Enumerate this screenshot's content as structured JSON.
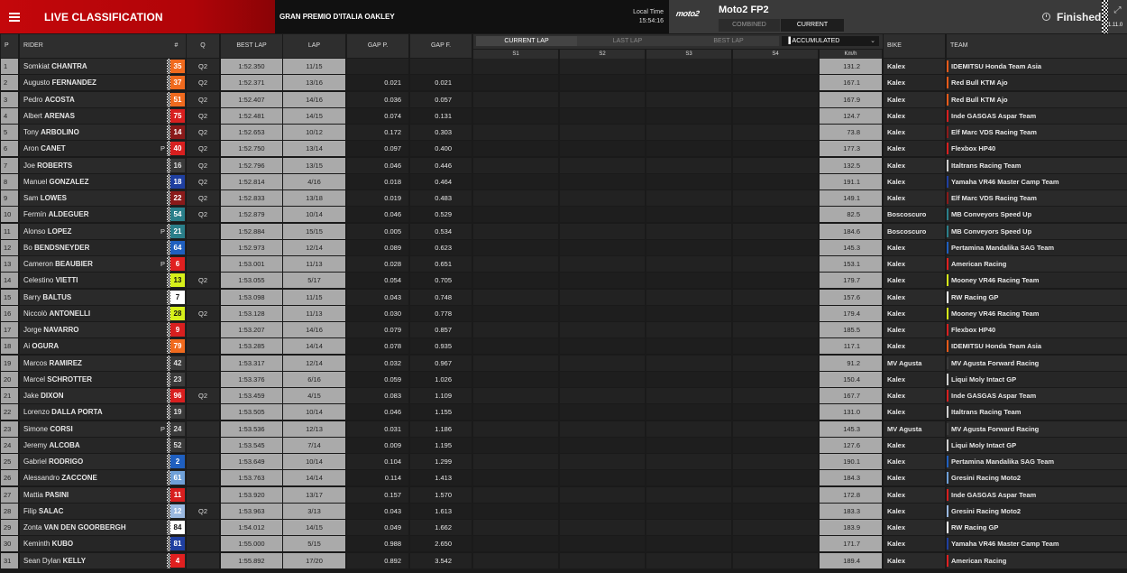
{
  "header": {
    "title": "LIVE CLASSIFICATION",
    "event": "GRAN PREMIO D'ITALIA OAKLEY",
    "local_time_label": "Local Time",
    "local_time": "15:54:16",
    "series_logo": "moto2",
    "session": "Moto2 FP2",
    "tabs": [
      "COMBINED",
      "CURRENT"
    ],
    "active_tab": "CURRENT",
    "status": "Finished",
    "version": "1.11.0"
  },
  "columns": {
    "p": "P",
    "rider": "RIDER",
    "num": "#",
    "q": "Q",
    "best_lap": "BEST LAP",
    "lap": "LAP",
    "gap_p": "GAP P.",
    "gap_f": "GAP F.",
    "bike": "BIKE",
    "team": "TEAM",
    "lap_tabs": [
      "CURRENT LAP",
      "LAST LAP",
      "BEST LAP"
    ],
    "accumulated": "ACCUMULATED",
    "sectors": [
      "S1",
      "S2",
      "S3",
      "S4"
    ],
    "kmh": "Km/h"
  },
  "rows": [
    {
      "p": "1",
      "first": "Somkiat",
      "last": "CHANTRA",
      "pit": "",
      "num": "35",
      "num_bg": "#f06a1e",
      "num_fg": "#ffffff",
      "q": "Q2",
      "best": "1:52.350",
      "lap": "11/15",
      "gapp": "",
      "gapf": "",
      "kmh": "131.2",
      "bike": "Kalex",
      "team": "IDEMITSU Honda Team Asia",
      "tcol": "#e85a1a"
    },
    {
      "p": "2",
      "first": "Augusto",
      "last": "FERNANDEZ",
      "pit": "",
      "num": "37",
      "num_bg": "#f06a1e",
      "num_fg": "#ffffff",
      "q": "Q2",
      "best": "1:52.371",
      "lap": "13/16",
      "gapp": "0.021",
      "gapf": "0.021",
      "kmh": "167.1",
      "bike": "Kalex",
      "team": "Red Bull KTM Ajo",
      "tcol": "#e85a1a"
    },
    {
      "p": "3",
      "first": "Pedro",
      "last": "ACOSTA",
      "pit": "",
      "num": "51",
      "num_bg": "#f06a1e",
      "num_fg": "#ffffff",
      "q": "Q2",
      "best": "1:52.407",
      "lap": "14/16",
      "gapp": "0.036",
      "gapf": "0.057",
      "kmh": "167.9",
      "bike": "Kalex",
      "team": "Red Bull KTM Ajo",
      "tcol": "#e85a1a"
    },
    {
      "p": "4",
      "first": "Albert",
      "last": "ARENAS",
      "pit": "",
      "num": "75",
      "num_bg": "#d81f1f",
      "num_fg": "#ffffff",
      "q": "Q2",
      "best": "1:52.481",
      "lap": "14/15",
      "gapp": "0.074",
      "gapf": "0.131",
      "kmh": "124.7",
      "bike": "Kalex",
      "team": "Inde GASGAS Aspar Team",
      "tcol": "#d81f1f"
    },
    {
      "p": "5",
      "first": "Tony",
      "last": "ARBOLINO",
      "pit": "",
      "num": "14",
      "num_bg": "#8a1a1a",
      "num_fg": "#ffffff",
      "q": "Q2",
      "best": "1:52.653",
      "lap": "10/12",
      "gapp": "0.172",
      "gapf": "0.303",
      "kmh": "73.8",
      "bike": "Kalex",
      "team": "Elf Marc VDS Racing Team",
      "tcol": "#8a1a1a"
    },
    {
      "p": "6",
      "first": "Aron",
      "last": "CANET",
      "pit": "P",
      "num": "40",
      "num_bg": "#d81f1f",
      "num_fg": "#ffffff",
      "q": "Q2",
      "best": "1:52.750",
      "lap": "13/14",
      "gapp": "0.097",
      "gapf": "0.400",
      "kmh": "177.3",
      "bike": "Kalex",
      "team": "Flexbox HP40",
      "tcol": "#d81f1f"
    },
    {
      "p": "7",
      "first": "Joe",
      "last": "ROBERTS",
      "pit": "",
      "num": "16",
      "num_bg": "#3a3a3a",
      "num_fg": "#e0e0e0",
      "q": "Q2",
      "best": "1:52.796",
      "lap": "13/15",
      "gapp": "0.046",
      "gapf": "0.446",
      "kmh": "132.5",
      "bike": "Kalex",
      "team": "Italtrans Racing Team",
      "tcol": "#cfcfcf"
    },
    {
      "p": "8",
      "first": "Manuel",
      "last": "GONZALEZ",
      "pit": "",
      "num": "18",
      "num_bg": "#1f3fa0",
      "num_fg": "#ffffff",
      "q": "Q2",
      "best": "1:52.814",
      "lap": "4/16",
      "gapp": "0.018",
      "gapf": "0.464",
      "kmh": "191.1",
      "bike": "Kalex",
      "team": "Yamaha VR46 Master Camp Team",
      "tcol": "#1f3fa0"
    },
    {
      "p": "9",
      "first": "Sam",
      "last": "LOWES",
      "pit": "",
      "num": "22",
      "num_bg": "#8a1a1a",
      "num_fg": "#ffffff",
      "q": "Q2",
      "best": "1:52.833",
      "lap": "13/18",
      "gapp": "0.019",
      "gapf": "0.483",
      "kmh": "149.1",
      "bike": "Kalex",
      "team": "Elf Marc VDS Racing Team",
      "tcol": "#8a1a1a"
    },
    {
      "p": "10",
      "first": "Fermín",
      "last": "ALDEGUER",
      "pit": "",
      "num": "54",
      "num_bg": "#2a7f8a",
      "num_fg": "#ffffff",
      "q": "Q2",
      "best": "1:52.879",
      "lap": "10/14",
      "gapp": "0.046",
      "gapf": "0.529",
      "kmh": "82.5",
      "bike": "Boscoscuro",
      "team": "MB Conveyors Speed Up",
      "tcol": "#2a7f8a"
    },
    {
      "p": "11",
      "first": "Alonso",
      "last": "LOPEZ",
      "pit": "P",
      "num": "21",
      "num_bg": "#2a7f8a",
      "num_fg": "#ffffff",
      "q": "",
      "best": "1:52.884",
      "lap": "15/15",
      "gapp": "0.005",
      "gapf": "0.534",
      "kmh": "184.6",
      "bike": "Boscoscuro",
      "team": "MB Conveyors Speed Up",
      "tcol": "#2a7f8a"
    },
    {
      "p": "12",
      "first": "Bo",
      "last": "BENDSNEYDER",
      "pit": "",
      "num": "64",
      "num_bg": "#1f5fbf",
      "num_fg": "#ffffff",
      "q": "",
      "best": "1:52.973",
      "lap": "12/14",
      "gapp": "0.089",
      "gapf": "0.623",
      "kmh": "145.3",
      "bike": "Kalex",
      "team": "Pertamina Mandalika SAG Team",
      "tcol": "#1f5fbf"
    },
    {
      "p": "13",
      "first": "Cameron",
      "last": "BEAUBIER",
      "pit": "P",
      "num": "6",
      "num_bg": "#e02020",
      "num_fg": "#ffffff",
      "q": "",
      "best": "1:53.001",
      "lap": "11/13",
      "gapp": "0.028",
      "gapf": "0.651",
      "kmh": "153.1",
      "bike": "Kalex",
      "team": "American Racing",
      "tcol": "#e02020"
    },
    {
      "p": "14",
      "first": "Celestino",
      "last": "VIETTI",
      "pit": "",
      "num": "13",
      "num_bg": "#d7f01a",
      "num_fg": "#111111",
      "q": "Q2",
      "best": "1:53.055",
      "lap": "5/17",
      "gapp": "0.054",
      "gapf": "0.705",
      "kmh": "179.7",
      "bike": "Kalex",
      "team": "Mooney VR46 Racing Team",
      "tcol": "#d7f01a"
    },
    {
      "p": "15",
      "first": "Barry",
      "last": "BALTUS",
      "pit": "",
      "num": "7",
      "num_bg": "#ffffff",
      "num_fg": "#111111",
      "q": "",
      "best": "1:53.098",
      "lap": "11/15",
      "gapp": "0.043",
      "gapf": "0.748",
      "kmh": "157.6",
      "bike": "Kalex",
      "team": "RW Racing GP",
      "tcol": "#ffffff"
    },
    {
      "p": "16",
      "first": "Niccolò",
      "last": "ANTONELLI",
      "pit": "",
      "num": "28",
      "num_bg": "#d7f01a",
      "num_fg": "#111111",
      "q": "Q2",
      "best": "1:53.128",
      "lap": "11/13",
      "gapp": "0.030",
      "gapf": "0.778",
      "kmh": "179.4",
      "bike": "Kalex",
      "team": "Mooney VR46 Racing Team",
      "tcol": "#d7f01a"
    },
    {
      "p": "17",
      "first": "Jorge",
      "last": "NAVARRO",
      "pit": "",
      "num": "9",
      "num_bg": "#d81f1f",
      "num_fg": "#ffffff",
      "q": "",
      "best": "1:53.207",
      "lap": "14/16",
      "gapp": "0.079",
      "gapf": "0.857",
      "kmh": "185.5",
      "bike": "Kalex",
      "team": "Flexbox HP40",
      "tcol": "#d81f1f"
    },
    {
      "p": "18",
      "first": "Ai",
      "last": "OGURA",
      "pit": "",
      "num": "79",
      "num_bg": "#f06a1e",
      "num_fg": "#ffffff",
      "q": "",
      "best": "1:53.285",
      "lap": "14/14",
      "gapp": "0.078",
      "gapf": "0.935",
      "kmh": "117.1",
      "bike": "Kalex",
      "team": "IDEMITSU Honda Team Asia",
      "tcol": "#e85a1a"
    },
    {
      "p": "19",
      "first": "Marcos",
      "last": "RAMIREZ",
      "pit": "",
      "num": "42",
      "num_bg": "#3a3a3a",
      "num_fg": "#e0e0e0",
      "q": "",
      "best": "1:53.317",
      "lap": "12/14",
      "gapp": "0.032",
      "gapf": "0.967",
      "kmh": "91.2",
      "bike": "MV Agusta",
      "team": "MV Agusta Forward Racing",
      "tcol": "#3a3a3a"
    },
    {
      "p": "20",
      "first": "Marcel",
      "last": "SCHROTTER",
      "pit": "",
      "num": "23",
      "num_bg": "#3a3a3a",
      "num_fg": "#e0e0e0",
      "q": "",
      "best": "1:53.376",
      "lap": "6/16",
      "gapp": "0.059",
      "gapf": "1.026",
      "kmh": "150.4",
      "bike": "Kalex",
      "team": "Liqui Moly Intact GP",
      "tcol": "#cfcfcf"
    },
    {
      "p": "21",
      "first": "Jake",
      "last": "DIXON",
      "pit": "",
      "num": "96",
      "num_bg": "#d81f1f",
      "num_fg": "#ffffff",
      "q": "Q2",
      "best": "1:53.459",
      "lap": "4/15",
      "gapp": "0.083",
      "gapf": "1.109",
      "kmh": "167.7",
      "bike": "Kalex",
      "team": "Inde GASGAS Aspar Team",
      "tcol": "#d81f1f"
    },
    {
      "p": "22",
      "first": "Lorenzo",
      "last": "DALLA PORTA",
      "pit": "",
      "num": "19",
      "num_bg": "#3a3a3a",
      "num_fg": "#e0e0e0",
      "q": "",
      "best": "1:53.505",
      "lap": "10/14",
      "gapp": "0.046",
      "gapf": "1.155",
      "kmh": "131.0",
      "bike": "Kalex",
      "team": "Italtrans Racing Team",
      "tcol": "#cfcfcf"
    },
    {
      "p": "23",
      "first": "Simone",
      "last": "CORSI",
      "pit": "P",
      "num": "24",
      "num_bg": "#3a3a3a",
      "num_fg": "#e0e0e0",
      "q": "",
      "best": "1:53.536",
      "lap": "12/13",
      "gapp": "0.031",
      "gapf": "1.186",
      "kmh": "145.3",
      "bike": "MV Agusta",
      "team": "MV Agusta Forward Racing",
      "tcol": "#3a3a3a"
    },
    {
      "p": "24",
      "first": "Jeremy",
      "last": "ALCOBA",
      "pit": "",
      "num": "52",
      "num_bg": "#3a3a3a",
      "num_fg": "#e0e0e0",
      "q": "",
      "best": "1:53.545",
      "lap": "7/14",
      "gapp": "0.009",
      "gapf": "1.195",
      "kmh": "127.6",
      "bike": "Kalex",
      "team": "Liqui Moly Intact GP",
      "tcol": "#cfcfcf"
    },
    {
      "p": "25",
      "first": "Gabriel",
      "last": "RODRIGO",
      "pit": "",
      "num": "2",
      "num_bg": "#1f5fbf",
      "num_fg": "#ffffff",
      "q": "",
      "best": "1:53.649",
      "lap": "10/14",
      "gapp": "0.104",
      "gapf": "1.299",
      "kmh": "190.1",
      "bike": "Kalex",
      "team": "Pertamina Mandalika SAG Team",
      "tcol": "#1f5fbf"
    },
    {
      "p": "26",
      "first": "Alessandro",
      "last": "ZACCONE",
      "pit": "",
      "num": "61",
      "num_bg": "#6fa0d8",
      "num_fg": "#ffffff",
      "q": "",
      "best": "1:53.763",
      "lap": "14/14",
      "gapp": "0.114",
      "gapf": "1.413",
      "kmh": "184.3",
      "bike": "Kalex",
      "team": "Gresini Racing Moto2",
      "tcol": "#6fa0d8"
    },
    {
      "p": "27",
      "first": "Mattia",
      "last": "PASINI",
      "pit": "",
      "num": "11",
      "num_bg": "#d81f1f",
      "num_fg": "#ffffff",
      "q": "",
      "best": "1:53.920",
      "lap": "13/17",
      "gapp": "0.157",
      "gapf": "1.570",
      "kmh": "172.8",
      "bike": "Kalex",
      "team": "Inde GASGAS Aspar Team",
      "tcol": "#d81f1f"
    },
    {
      "p": "28",
      "first": "Filip",
      "last": "SALAC",
      "pit": "",
      "num": "12",
      "num_bg": "#9ab8e0",
      "num_fg": "#ffffff",
      "q": "Q2",
      "best": "1:53.963",
      "lap": "3/13",
      "gapp": "0.043",
      "gapf": "1.613",
      "kmh": "183.3",
      "bike": "Kalex",
      "team": "Gresini Racing Moto2",
      "tcol": "#9ab8e0"
    },
    {
      "p": "29",
      "first": "Zonta",
      "last": "VAN DEN GOORBERGH",
      "pit": "",
      "num": "84",
      "num_bg": "#ffffff",
      "num_fg": "#111111",
      "q": "",
      "best": "1:54.012",
      "lap": "14/15",
      "gapp": "0.049",
      "gapf": "1.662",
      "kmh": "183.9",
      "bike": "Kalex",
      "team": "RW Racing GP",
      "tcol": "#ffffff"
    },
    {
      "p": "30",
      "first": "Keminth",
      "last": "KUBO",
      "pit": "",
      "num": "81",
      "num_bg": "#1f3fa0",
      "num_fg": "#ffffff",
      "q": "",
      "best": "1:55.000",
      "lap": "5/15",
      "gapp": "0.988",
      "gapf": "2.650",
      "kmh": "171.7",
      "bike": "Kalex",
      "team": "Yamaha VR46 Master Camp Team",
      "tcol": "#1f3fa0"
    },
    {
      "p": "31",
      "first": "Sean Dylan",
      "last": "KELLY",
      "pit": "",
      "num": "4",
      "num_bg": "#e02020",
      "num_fg": "#ffffff",
      "q": "",
      "best": "1:55.892",
      "lap": "17/20",
      "gapp": "0.892",
      "gapf": "3.542",
      "kmh": "189.4",
      "bike": "Kalex",
      "team": "American Racing",
      "tcol": "#e02020"
    }
  ]
}
